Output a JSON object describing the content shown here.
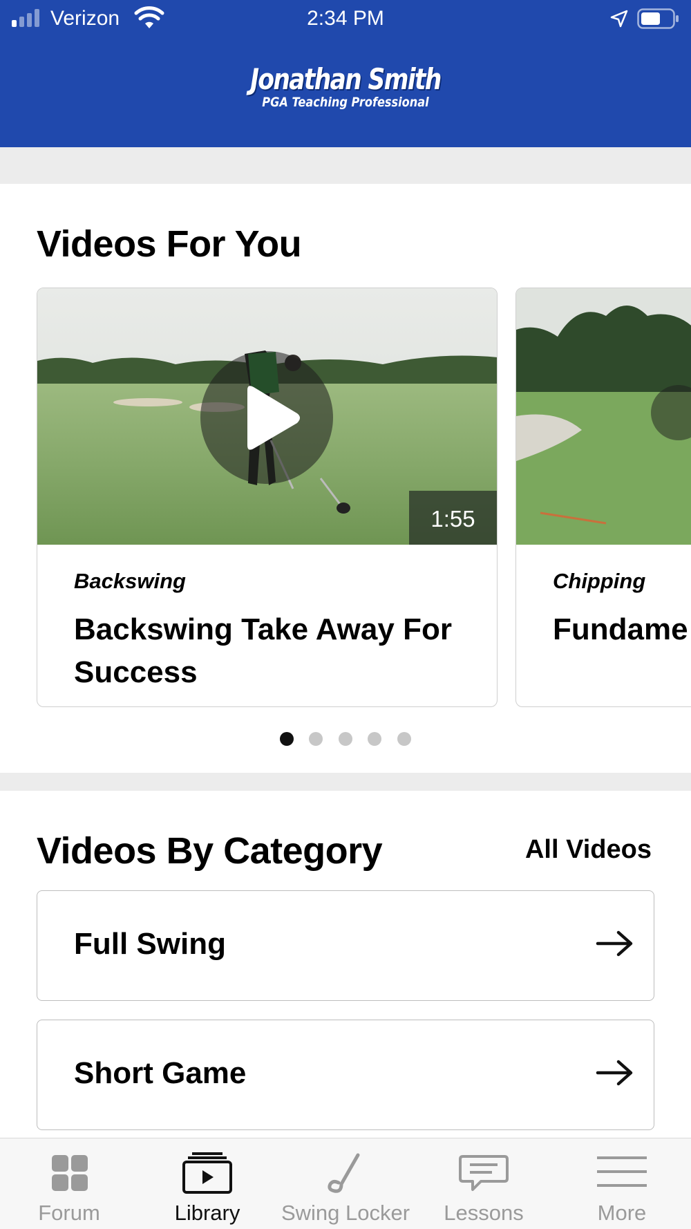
{
  "status_bar": {
    "carrier": "Verizon",
    "time": "2:34 PM"
  },
  "header": {
    "logo_name": "Jonathan Smith",
    "logo_subtitle": "PGA Teaching Professional",
    "background_color": "#2049ad"
  },
  "videos_for_you": {
    "title": "Videos For You",
    "cards": [
      {
        "category": "Backswing",
        "title": "Backswing Take Away For Success",
        "duration": "1:55"
      },
      {
        "category": "Chipping",
        "title": "Fundame"
      }
    ],
    "pager": {
      "total": 5,
      "active_index": 0
    }
  },
  "videos_by_category": {
    "title": "Videos By Category",
    "all_videos_label": "All Videos",
    "categories": [
      {
        "label": "Full Swing"
      },
      {
        "label": "Short Game"
      }
    ]
  },
  "tab_bar": {
    "tabs": [
      {
        "label": "Forum",
        "icon": "grid-icon",
        "active": false
      },
      {
        "label": "Library",
        "icon": "video-library-icon",
        "active": true
      },
      {
        "label": "Swing Locker",
        "icon": "golf-club-icon",
        "active": false
      },
      {
        "label": "Lessons",
        "icon": "chat-bubble-icon",
        "active": false
      },
      {
        "label": "More",
        "icon": "menu-icon",
        "active": false
      }
    ]
  }
}
